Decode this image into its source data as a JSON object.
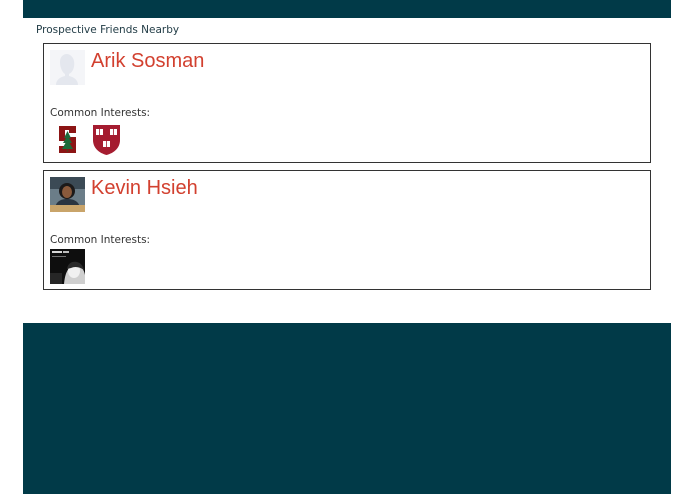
{
  "page": {
    "section_title": "Prospective Friends Nearby"
  },
  "colors": {
    "header_bg": "#013a48",
    "footer_bg": "#013a48",
    "name_color": "#d2402f",
    "card_border": "#333333"
  },
  "friends": [
    {
      "name": "Arik Sosman",
      "avatar": "default-silhouette-avatar",
      "interests_label": "Common Interests:",
      "interests": [
        {
          "icon": "stanford-logo-icon"
        },
        {
          "icon": "harvard-shield-icon"
        }
      ]
    },
    {
      "name": "Kevin Hsieh",
      "avatar": "profile-photo-avatar",
      "interests_label": "Common Interests:",
      "interests": [
        {
          "icon": "black-white-photo-icon"
        }
      ]
    }
  ]
}
